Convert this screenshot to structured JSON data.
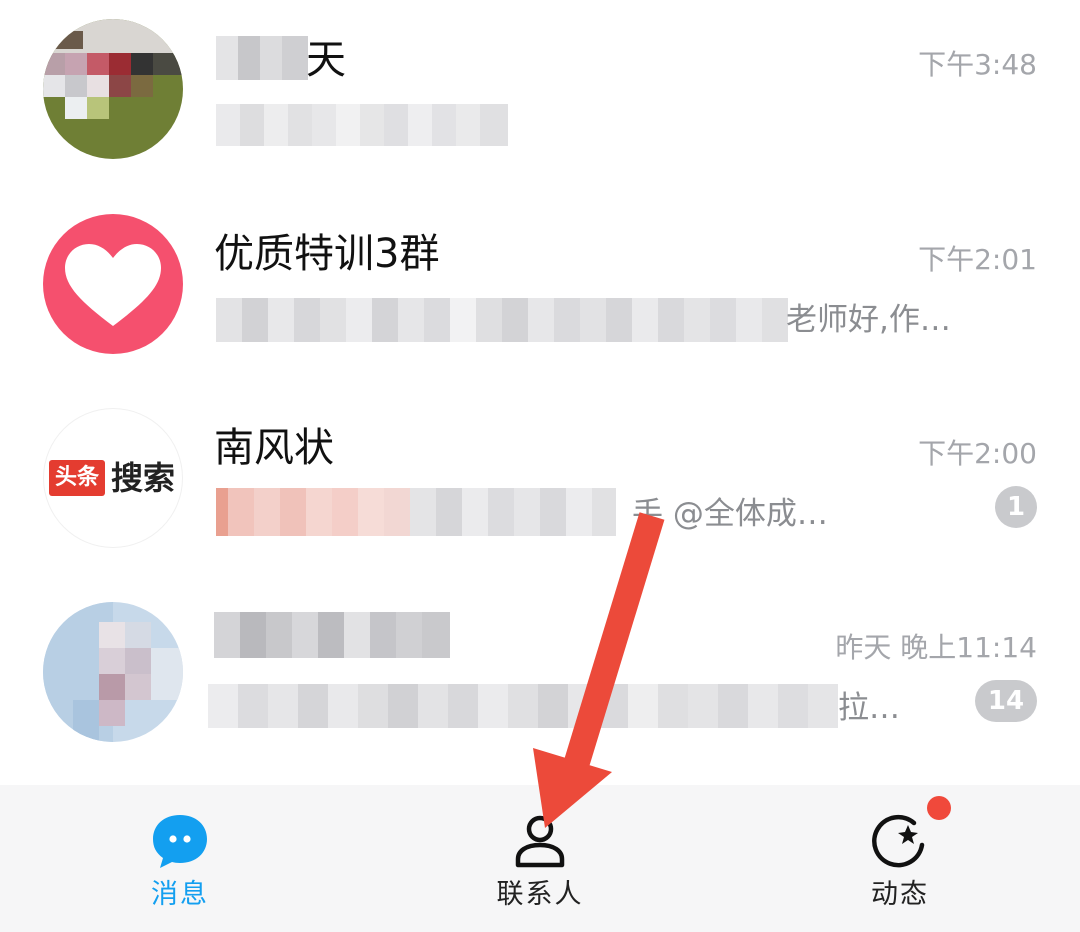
{
  "chats": [
    {
      "title_visible": "天",
      "time": "下午3:48",
      "preview": "",
      "badge": ""
    },
    {
      "title_visible": "优质特训3群",
      "time": "下午2:01",
      "preview": "老师好,作…",
      "badge": ""
    },
    {
      "title_visible": "南风状",
      "time": "下午2:00",
      "preview": "手 @全体成…",
      "badge": "1",
      "avatar_text_a": "头条",
      "avatar_text_b": "搜索"
    },
    {
      "title_visible": "",
      "time": "昨天 晚上11:14",
      "preview": "拉…",
      "badge": "14"
    }
  ],
  "tabs": [
    {
      "label": "消息",
      "icon": "message-bubble-icon",
      "active": true
    },
    {
      "label": "联系人",
      "icon": "contacts-person-icon",
      "active": false
    },
    {
      "label": "动态",
      "icon": "moments-star-icon",
      "active": false,
      "has_red_dot": true
    }
  ],
  "colors": {
    "accent": "#139ff0",
    "badge": "#c9cacd",
    "red_dot": "#f0493b",
    "arrow": "#ec4a3a",
    "heart_avatar": "#f5506e"
  }
}
